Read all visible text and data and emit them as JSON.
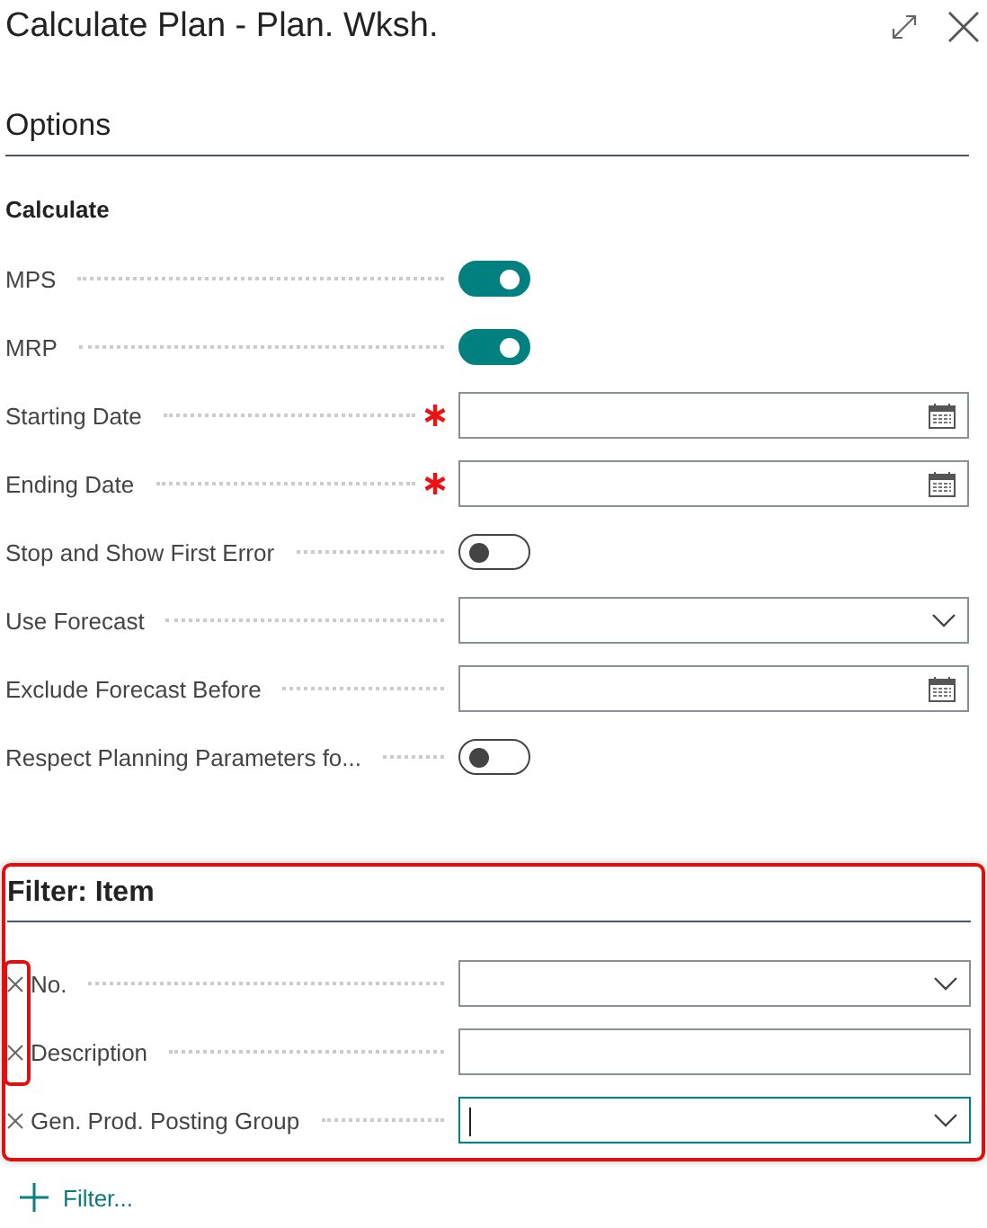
{
  "window": {
    "title": "Calculate Plan - Plan. Wksh."
  },
  "options": {
    "heading": "Options",
    "group": "Calculate",
    "fields": [
      {
        "kind": "toggle",
        "label": "MPS",
        "on": true
      },
      {
        "kind": "toggle",
        "label": "MRP",
        "on": true
      },
      {
        "kind": "date",
        "label": "Starting Date",
        "required": true
      },
      {
        "kind": "date",
        "label": "Ending Date",
        "required": true
      },
      {
        "kind": "toggle",
        "label": "Stop and Show First Error",
        "on": false
      },
      {
        "kind": "select",
        "label": "Use Forecast"
      },
      {
        "kind": "date",
        "label": "Exclude Forecast Before"
      },
      {
        "kind": "toggle",
        "label": "Respect Planning Parameters fo...",
        "on": false
      }
    ]
  },
  "filter": {
    "heading": "Filter: Item",
    "highlighted": true,
    "remove_icons_highlighted": true,
    "fields": [
      {
        "kind": "select",
        "label": "No.",
        "focused": false
      },
      {
        "kind": "text",
        "label": "Description",
        "focused": false
      },
      {
        "kind": "select",
        "label": "Gen. Prod. Posting Group",
        "focused": true
      }
    ]
  },
  "add_filter": {
    "label": "Filter..."
  }
}
